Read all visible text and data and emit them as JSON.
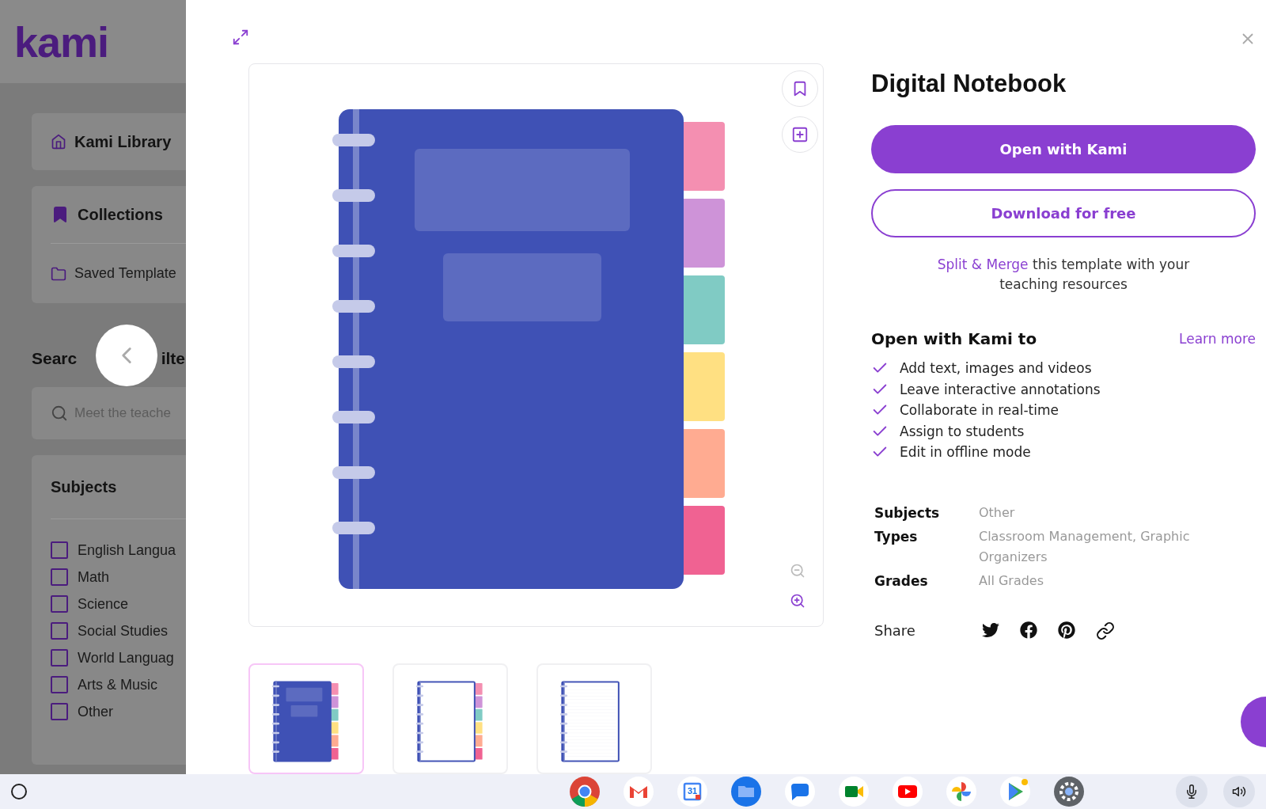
{
  "sidebar": {
    "logo": "kami",
    "library_item": {
      "label": "Kami Library"
    },
    "collections": {
      "title": "Collections",
      "items": [
        {
          "label": "Saved Template"
        }
      ]
    },
    "search": {
      "heading_start": "Searc",
      "heading_end": "ilte",
      "placeholder": "Meet the teache"
    },
    "subjects": {
      "title": "Subjects",
      "items": [
        {
          "label": "English Langua",
          "checked": false
        },
        {
          "label": "Math",
          "checked": false
        },
        {
          "label": "Science",
          "checked": false
        },
        {
          "label": "Social Studies",
          "checked": false
        },
        {
          "label": "World Languag",
          "checked": false
        },
        {
          "label": "Arts & Music",
          "checked": false
        },
        {
          "label": "Other",
          "checked": false
        }
      ]
    }
  },
  "detail": {
    "title": "Digital Notebook",
    "primary_button": "Open with Kami",
    "secondary_button": "Download for free",
    "split_merge": {
      "link": "Split & Merge",
      "text": "this template with your teaching resources"
    },
    "features_heading": "Open with Kami to",
    "learn_more": "Learn more",
    "features": [
      "Add text, images and videos",
      "Leave interactive annotations",
      "Collaborate in real-time",
      "Assign to students",
      "Edit in offline mode"
    ],
    "meta": [
      {
        "label": "Subjects",
        "value": "Other"
      },
      {
        "label": "Types",
        "value": "Classroom Management, Graphic Organizers"
      },
      {
        "label": "Grades",
        "value": "All Grades"
      }
    ],
    "share_label": "Share",
    "share": [
      {
        "kind": "twitter"
      },
      {
        "kind": "facebook"
      },
      {
        "kind": "pinterest"
      },
      {
        "kind": "link"
      }
    ]
  },
  "thumbnails": [
    {
      "kind": "cover",
      "selected": true
    },
    {
      "kind": "tabs",
      "selected": false
    },
    {
      "kind": "lined",
      "selected": false
    }
  ],
  "taskbar": {
    "apps": [
      {
        "kind": "chrome"
      },
      {
        "kind": "gmail"
      },
      {
        "kind": "calendar",
        "label": "31"
      },
      {
        "kind": "files"
      },
      {
        "kind": "messages"
      },
      {
        "kind": "meet"
      },
      {
        "kind": "youtube"
      },
      {
        "kind": "photos"
      },
      {
        "kind": "play"
      },
      {
        "kind": "settings"
      }
    ]
  }
}
